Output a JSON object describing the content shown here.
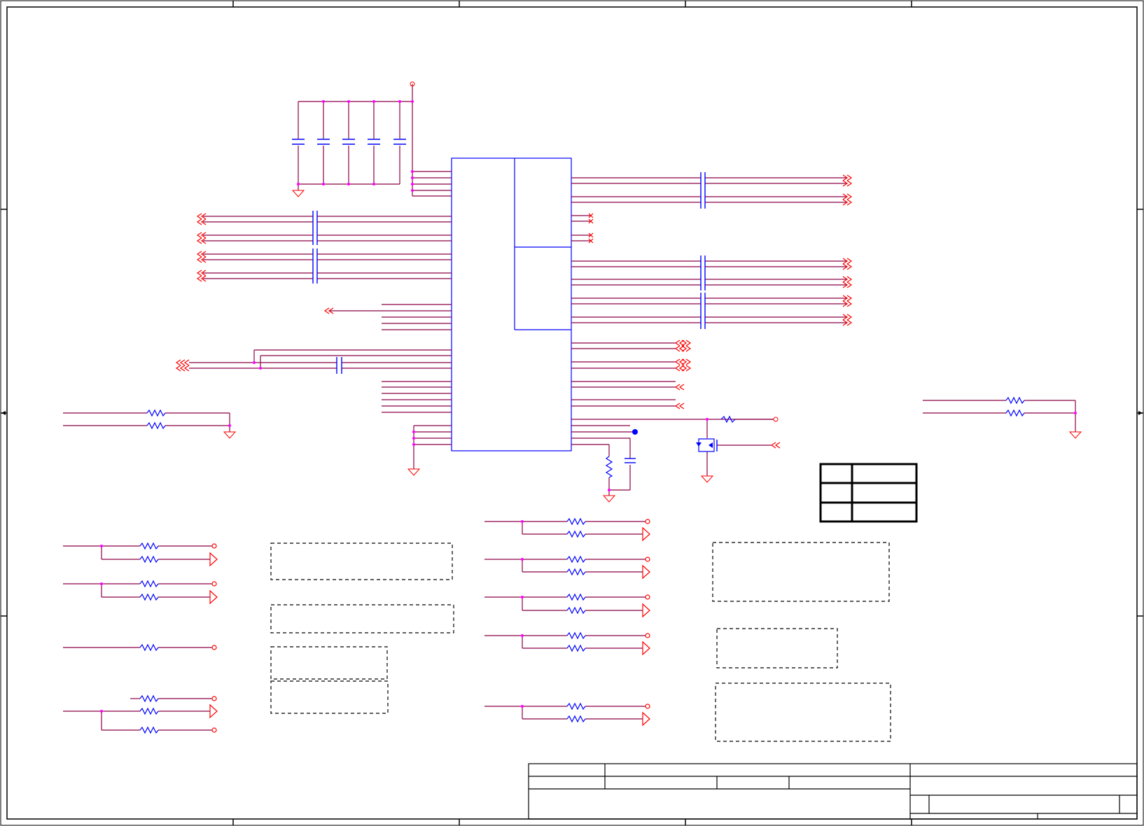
{
  "sheet": {
    "title": "",
    "colors": {
      "border": "#000000",
      "wire": "#8b0046",
      "net_port": "#ff0000",
      "component": "#0000ff",
      "junction": "#ff00ff",
      "dashed_box": "#000000"
    },
    "zones": {
      "columns": 5,
      "rows": 4
    }
  },
  "chip": {
    "name": "",
    "sections": 2
  },
  "capacitor_bank": {
    "count": 5
  },
  "legend_table": {
    "rows": 3,
    "cells": [
      "",
      "",
      "",
      "",
      "",
      ""
    ]
  },
  "notes": {
    "count": 7,
    "texts": [
      "",
      "",
      "",
      "",
      "",
      "",
      ""
    ]
  },
  "title_block": {
    "company": "",
    "title": "",
    "size": "",
    "document_number": "",
    "revision": "",
    "date": "",
    "sheet": ""
  }
}
